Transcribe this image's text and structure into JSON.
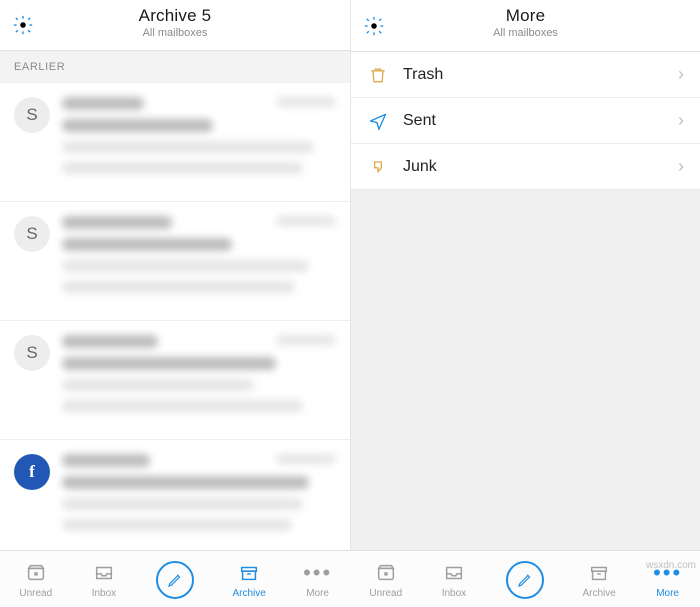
{
  "left": {
    "title": "Archive 5",
    "subtitle": "All mailboxes",
    "section": "EARLIER",
    "messages": [
      {
        "avatar_type": "gray",
        "avatar_text": "S"
      },
      {
        "avatar_type": "gray",
        "avatar_text": "S"
      },
      {
        "avatar_type": "gray",
        "avatar_text": "S"
      },
      {
        "avatar_type": "fb",
        "avatar_text": "f"
      }
    ]
  },
  "right": {
    "title": "More",
    "subtitle": "All mailboxes",
    "folders": [
      {
        "icon": "trash",
        "label": "Trash"
      },
      {
        "icon": "sent",
        "label": "Sent"
      },
      {
        "icon": "junk",
        "label": "Junk"
      }
    ]
  },
  "toolbar_left": {
    "tabs": [
      {
        "id": "unread",
        "label": "Unread"
      },
      {
        "id": "inbox",
        "label": "Inbox"
      },
      {
        "id": "compose",
        "label": ""
      },
      {
        "id": "archive",
        "label": "Archive",
        "active": true
      },
      {
        "id": "more",
        "label": "More"
      }
    ]
  },
  "toolbar_right": {
    "tabs": [
      {
        "id": "unread",
        "label": "Unread"
      },
      {
        "id": "inbox",
        "label": "Inbox"
      },
      {
        "id": "compose",
        "label": ""
      },
      {
        "id": "archive",
        "label": "Archive"
      },
      {
        "id": "more",
        "label": "More",
        "active": true
      }
    ]
  },
  "watermark": "wsxdn.com"
}
